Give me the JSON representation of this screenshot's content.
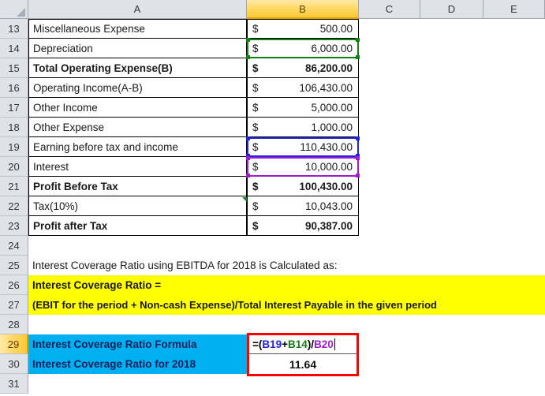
{
  "grid": {
    "column_headers": [
      "A",
      "B",
      "C",
      "D",
      "E"
    ],
    "active_column": "B",
    "active_row": "29",
    "row_numbers": [
      "13",
      "14",
      "15",
      "16",
      "17",
      "18",
      "19",
      "20",
      "21",
      "22",
      "23",
      "24",
      "25",
      "26",
      "27",
      "28",
      "29",
      "30",
      "31"
    ]
  },
  "colors": {
    "header_fill": "#DFE3E8",
    "active_header_fill": "#FFD65C",
    "highlight_yellow": "#FFFF00",
    "highlight_cyan": "#00B0F0",
    "cyan_text": "#10205C",
    "edit_border": "#FF0000",
    "ref_blue": "#2222DD",
    "ref_green": "#128015",
    "ref_purple": "#A11BD1"
  },
  "rows": [
    {
      "num": "13",
      "label": "Miscellaneous Expense",
      "symbol": "$",
      "value": "500.00",
      "bold": false
    },
    {
      "num": "14",
      "label": "Depreciation",
      "symbol": "$",
      "value": "6,000.00",
      "bold": false
    },
    {
      "num": "15",
      "label": "Total Operating Expense(B)",
      "symbol": "$",
      "value": "86,200.00",
      "bold": true
    },
    {
      "num": "16",
      "label": "Operating Income(A-B)",
      "symbol": "$",
      "value": "106,430.00",
      "bold": false
    },
    {
      "num": "17",
      "label": "Other Income",
      "symbol": "$",
      "value": "5,000.00",
      "bold": false
    },
    {
      "num": "18",
      "label": "Other Expense",
      "symbol": "$",
      "value": "1,000.00",
      "bold": false
    },
    {
      "num": "19",
      "label": "Earning before tax and income",
      "symbol": "$",
      "value": "110,430.00",
      "bold": false
    },
    {
      "num": "20",
      "label": "Interest",
      "symbol": "$",
      "value": "10,000.00",
      "bold": false
    },
    {
      "num": "21",
      "label": "Profit Before Tax",
      "symbol": "$",
      "value": "100,430.00",
      "bold": true
    },
    {
      "num": "22",
      "label": "Tax(10%)",
      "symbol": "$",
      "value": "10,043.00",
      "bold": false
    },
    {
      "num": "23",
      "label": "Profit after Tax",
      "symbol": "$",
      "value": "90,387.00",
      "bold": true
    }
  ],
  "notes": {
    "row25": "Interest Coverage Ratio using EBITDA for 2018 is Calculated as:",
    "row26": "Interest Coverage Ratio =",
    "row27": "(EBIT for the period + Non-cash Expense)/Total Interest Payable in the given period"
  },
  "calc": {
    "formula_label": "Interest Coverage Ratio Formula",
    "result_label": "Interest Coverage Ratio  for 2018",
    "formula_tokens": [
      {
        "text": "=(",
        "color": "#000000"
      },
      {
        "text": "B19",
        "color": "#2222DD"
      },
      {
        "text": "+",
        "color": "#000000"
      },
      {
        "text": "B14",
        "color": "#128015"
      },
      {
        "text": ")/",
        "color": "#000000"
      },
      {
        "text": "B20",
        "color": "#A11BD1"
      }
    ],
    "formula_text": "=(B19+B14)/B20",
    "result_value": "11.64"
  },
  "references": [
    {
      "cell": "B19",
      "color": "#2222DD"
    },
    {
      "cell": "B14",
      "color": "#128015"
    },
    {
      "cell": "B20",
      "color": "#A11BD1"
    }
  ]
}
